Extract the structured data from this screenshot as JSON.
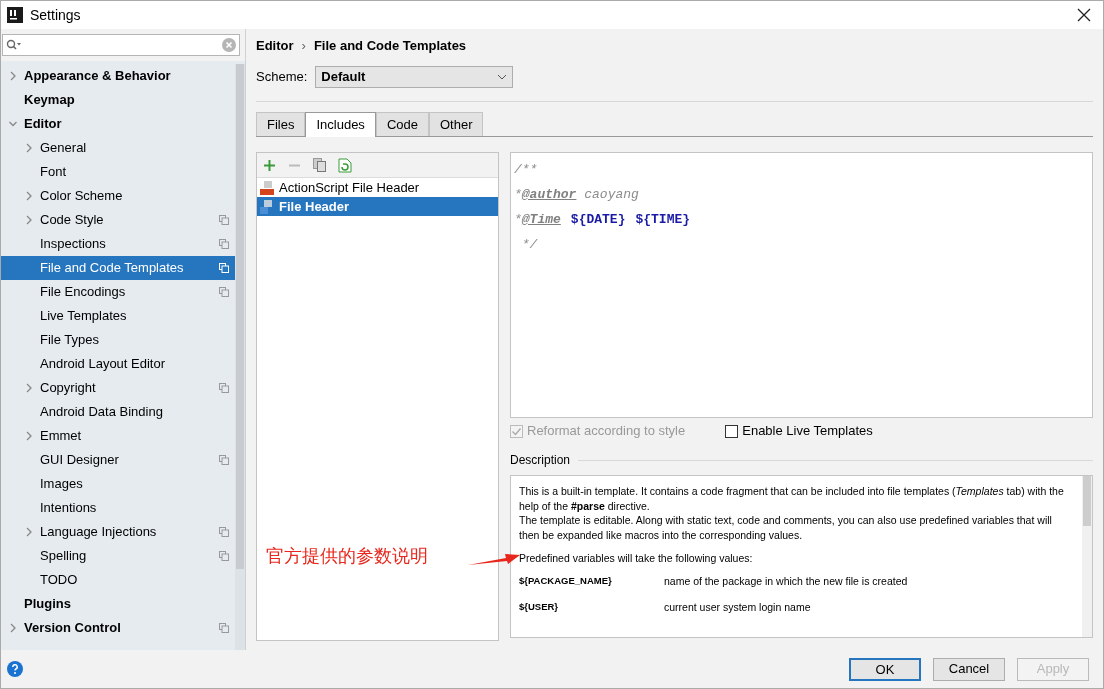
{
  "window": {
    "title": "Settings"
  },
  "sidebar": {
    "items": [
      {
        "label": "Appearance & Behavior",
        "expanded": false
      },
      {
        "label": "Keymap"
      },
      {
        "label": "Editor",
        "expanded": true,
        "children": [
          {
            "label": "General",
            "expanded": false,
            "selected": false
          },
          {
            "label": "Font",
            "selected": false
          },
          {
            "label": "Color Scheme",
            "expanded": false,
            "selected": false
          },
          {
            "label": "Code Style",
            "expanded": false,
            "scoped": true,
            "selected": false
          },
          {
            "label": "Inspections",
            "scoped": true,
            "selected": false
          },
          {
            "label": "File and Code Templates",
            "scoped": true,
            "selected": true
          },
          {
            "label": "File Encodings",
            "scoped": true,
            "selected": false
          },
          {
            "label": "Live Templates",
            "selected": false
          },
          {
            "label": "File Types",
            "selected": false
          },
          {
            "label": "Android Layout Editor",
            "selected": false
          },
          {
            "label": "Copyright",
            "expanded": false,
            "scoped": true,
            "selected": false
          },
          {
            "label": "Android Data Binding",
            "selected": false
          },
          {
            "label": "Emmet",
            "expanded": false,
            "selected": false
          },
          {
            "label": "GUI Designer",
            "scoped": true,
            "selected": false
          },
          {
            "label": "Images",
            "selected": false
          },
          {
            "label": "Intentions",
            "selected": false
          },
          {
            "label": "Language Injections",
            "expanded": false,
            "scoped": true,
            "selected": false
          },
          {
            "label": "Spelling",
            "scoped": true,
            "selected": false
          },
          {
            "label": "TODO",
            "selected": false
          }
        ]
      },
      {
        "label": "Plugins"
      },
      {
        "label": "Version Control",
        "expanded": false,
        "scoped": true
      }
    ]
  },
  "breadcrumb": [
    "Editor",
    "File and Code Templates"
  ],
  "breadcrumb_separator": "›",
  "scheme": {
    "label": "Scheme:",
    "value": "Default"
  },
  "tabs": [
    {
      "label": "Files",
      "selected": false
    },
    {
      "label": "Includes",
      "selected": true
    },
    {
      "label": "Code",
      "selected": false
    },
    {
      "label": "Other",
      "selected": false
    }
  ],
  "templates": [
    {
      "label": "ActionScript File Header",
      "kind": "actionscript",
      "selected": false
    },
    {
      "label": "File Header",
      "kind": "file",
      "selected": true
    }
  ],
  "editor": {
    "lines": [
      [
        {
          "kind": "comment",
          "text": "/**"
        }
      ],
      [
        {
          "kind": "comment",
          "text": "*"
        },
        {
          "kind": "tag",
          "text": "@author"
        },
        {
          "kind": "comment",
          "text": " caoyang"
        }
      ],
      [
        {
          "kind": "comment",
          "text": "*"
        },
        {
          "kind": "tag",
          "text": "@Time"
        },
        {
          "kind": "variable",
          "text": "${DATE}"
        },
        {
          "kind": "variable",
          "text": "${TIME}"
        }
      ],
      [
        {
          "kind": "comment",
          "text": " */"
        }
      ]
    ]
  },
  "options": [
    {
      "label": "Reformat according to style",
      "checked": true,
      "disabled": true
    },
    {
      "label": "Enable Live Templates",
      "checked": false,
      "disabled": false
    }
  ],
  "description": {
    "title": "Description",
    "paragraphs": [
      "This is a built-in template. It contains a code fragment that can be included into file templates (*Templates* tab) with the help of the **#parse** directive.",
      "The template is editable. Along with static text, code and comments, you can also use predefined variables that will then be expanded like macros into the corresponding values."
    ],
    "variables_intro": "Predefined variables will take the following values:",
    "variables": [
      {
        "name": "${PACKAGE_NAME}",
        "meaning": "name of the package in which the new file is created"
      },
      {
        "name": "${USER}",
        "meaning": "current user system login name"
      }
    ]
  },
  "annotation": {
    "text": "官方提供的参数说明"
  },
  "buttons": [
    {
      "label": "OK",
      "kind": "default",
      "disabled": false
    },
    {
      "label": "Cancel",
      "kind": "normal",
      "disabled": false
    },
    {
      "label": "Apply",
      "kind": "normal",
      "disabled": true
    }
  ]
}
